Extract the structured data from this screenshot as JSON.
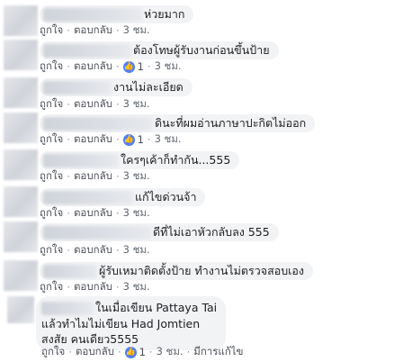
{
  "actions": {
    "like": "ถูกใจ",
    "reply": "ตอบกลับ",
    "edited": "มีการแก้ไข",
    "separator": "·"
  },
  "comments": [
    {
      "text": "ห่วยมาก",
      "time": "3 ชม.",
      "reactions": null
    },
    {
      "text": "ต้องโทษผู้รับงานก่อนขึ้นป้าย",
      "time": "3 ชม.",
      "reactions": "1"
    },
    {
      "text": "งานไม่ละเอียด",
      "time": "3 ชม.",
      "reactions": null
    },
    {
      "text": "ดินะที่ผมอ่านภาษาปะกิตไม่ออก",
      "time": "3 ชม.",
      "reactions": "1"
    },
    {
      "text": "ใครๆเค้าก็ทำกัน...555",
      "time": "3 ชม.",
      "reactions": null
    },
    {
      "text": "แก้ไขด่วนจ้า",
      "time": "3 ชม.",
      "reactions": null
    },
    {
      "text": "ดีที่ไม่เอาหัวกลับลง 555",
      "time": "3 ชม.",
      "reactions": null
    },
    {
      "text": "ผู้รับเหมาติดตั้งป้าย ทำงานไม่ตรวจสอบเอง",
      "time": "3 ชม.",
      "reactions": null
    },
    {
      "lines": [
        "ในเมื่อเขียน Pattaya Tai",
        "แล้วทำไมไม่เขียน Had Jomtien",
        "สงสัย คนเดียว5555"
      ],
      "time": "3 ชม.",
      "reactions": "1",
      "edited": true
    }
  ],
  "colors": {
    "bubble": "#f2f3f5",
    "reaction": "#4f7ff6",
    "meta": "#606770"
  },
  "icons": {
    "reaction": "like-icon"
  }
}
